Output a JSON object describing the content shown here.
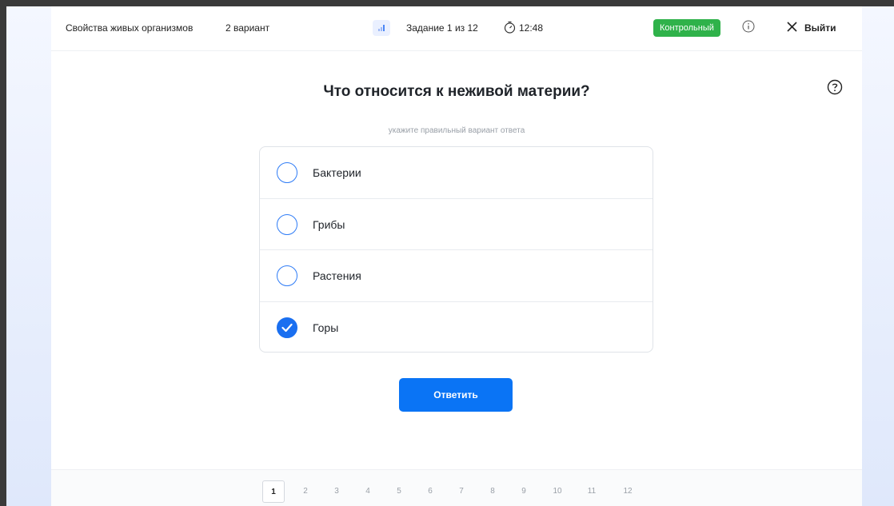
{
  "header": {
    "subject": "Свойства живых организмов",
    "variant": "2 вариант",
    "task_counter": "Задание 1 из 12",
    "timer": "12:48",
    "mode_badge": "Контрольный",
    "exit_label": "Выйти"
  },
  "question": {
    "title": "Что относится к неживой материи?",
    "hint": "укажите правильный вариант ответа",
    "options": [
      {
        "label": "Бактерии",
        "selected": false
      },
      {
        "label": "Грибы",
        "selected": false
      },
      {
        "label": "Растения",
        "selected": false
      },
      {
        "label": "Горы",
        "selected": true
      }
    ]
  },
  "actions": {
    "answer_label": "Ответить"
  },
  "pagination": {
    "pages": [
      "1",
      "2",
      "3",
      "4",
      "5",
      "6",
      "7",
      "8",
      "9",
      "10",
      "11",
      "12"
    ],
    "current": 1
  },
  "colors": {
    "accent": "#0a74f5",
    "badge": "#2fb24a"
  },
  "icons": [
    "signal-icon",
    "timer-icon",
    "info-icon",
    "close-icon",
    "help-icon",
    "check-icon"
  ]
}
